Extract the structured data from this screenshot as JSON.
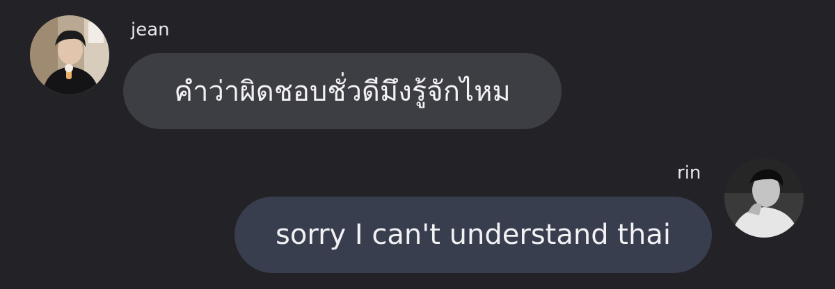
{
  "messages": [
    {
      "sender": "jean",
      "text": "คำว่าผิดชอบชั่วดีมึงรู้จักไหม",
      "avatar_icon": "avatar-photo-icon",
      "side": "left",
      "bubble_color": "#3d3d44"
    },
    {
      "sender": "rin",
      "text": "sorry I can't understand thai",
      "avatar_icon": "avatar-photo-icon",
      "side": "right",
      "bubble_color": "#393e4f"
    }
  ],
  "colors": {
    "background": "#222227",
    "text": "#f2f2f4",
    "name_text": "#e6e6ea"
  }
}
